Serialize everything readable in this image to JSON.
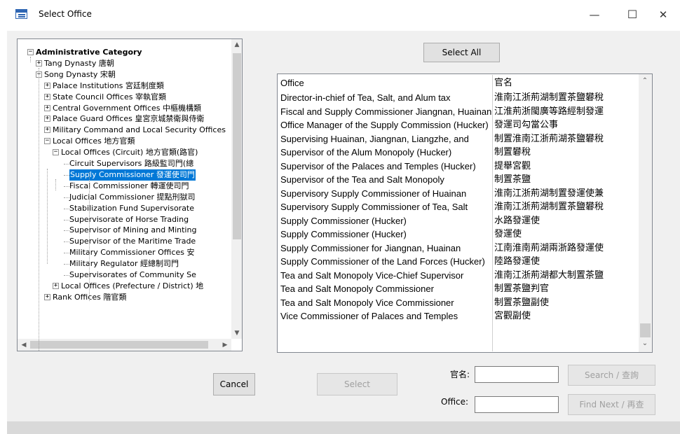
{
  "window": {
    "title": "Select Office",
    "minimize": "—",
    "maximize": "☐",
    "close": "✕"
  },
  "tree": {
    "root": "Administrative Category",
    "items": [
      {
        "label": "Tang Dynasty 唐朝",
        "exp": "+"
      },
      {
        "label": "Song Dynasty 宋朝",
        "exp": "-"
      },
      {
        "label": "Palace Institutions 宮廷制度類",
        "exp": "+"
      },
      {
        "label": "State Council Offices 宰執官類",
        "exp": "+"
      },
      {
        "label": "Central Government Offices 中樞機構類",
        "exp": "+"
      },
      {
        "label": "Palace Guard Offices 皇宮京城禁衛與侍衛",
        "exp": "+"
      },
      {
        "label": "Military Command and Local Security Offices",
        "exp": "+"
      },
      {
        "label": "Local Offices 地方官類",
        "exp": "-"
      },
      {
        "label": "Local Offices (Circuit) 地方官類(路官)",
        "exp": "-"
      },
      {
        "label": "Circuit Supervisors 路級監司門(總",
        "exp": ""
      },
      {
        "label": "Supply Commissioner 發運使司門",
        "exp": ""
      },
      {
        "label": "Fiscal Commissioner 轉運使司門",
        "exp": ""
      },
      {
        "label": "Judicial Commissioner 提點刑獄司",
        "exp": ""
      },
      {
        "label": "Stabilization Fund Supervisorate",
        "exp": ""
      },
      {
        "label": "Supervisorate of Horse Trading",
        "exp": ""
      },
      {
        "label": "Supervisor of Mining and Minting",
        "exp": ""
      },
      {
        "label": "Supervisor of the Maritime Trade",
        "exp": ""
      },
      {
        "label": "Military Commissioner Offices 安",
        "exp": ""
      },
      {
        "label": "Military Regulator 經總制司門",
        "exp": ""
      },
      {
        "label": "Supervisorates of Community Se",
        "exp": ""
      },
      {
        "label": "Local Offices (Prefecture / District) 地",
        "exp": "+"
      },
      {
        "label": "Rank Offices 階官類",
        "exp": "+"
      }
    ]
  },
  "buttons": {
    "select_all": "Select All",
    "cancel": "Cancel",
    "select": "Select",
    "search": "Search / 查詢",
    "find_next": "Find Next / 再查"
  },
  "list": {
    "headers": [
      "Office",
      "官名"
    ],
    "rows": [
      [
        "Director-in-chief of Tea, Salt, and Alum tax",
        "淮南江浙荊湖制置茶鹽礬稅"
      ],
      [
        "Fiscal and Supply Commissioner Jiangnan, Huainan",
        "江淮荊浙閩廣等路經制發運"
      ],
      [
        "Office Manager of the Supply Commission (Hucker)",
        "發運司勾當公事"
      ],
      [
        "Supervising Huainan, Jiangnan, Liangzhe, and",
        "制置淮南江浙荊湖茶鹽礬稅"
      ],
      [
        "Supervisor of the Alum Monopoly (Hucker)",
        "制置礬稅"
      ],
      [
        "Supervisor of the Palaces and Temples (Hucker)",
        "提舉宮觀"
      ],
      [
        "Supervisor of the Tea and Salt Monopoly",
        "制置茶鹽"
      ],
      [
        "Supervisory Supply Commissioner of Huainan",
        "淮南江浙荊湖制置發運使兼"
      ],
      [
        "Supervisory Supply Commissioner of Tea, Salt",
        "淮南江浙荊湖制置茶鹽礬稅"
      ],
      [
        "Supply Commissioner (Hucker)",
        "水路發運使"
      ],
      [
        "Supply Commissioner (Hucker)",
        "發運使"
      ],
      [
        "Supply Commissioner for Jiangnan, Huainan",
        "江南淮南荊湖兩浙路發運使"
      ],
      [
        "Supply Commissioner of the Land Forces (Hucker)",
        "陸路發運使"
      ],
      [
        "Tea and Salt Monopoly  Vice-Chief Supervisor",
        "淮南江浙荊湖都大制置茶鹽"
      ],
      [
        "Tea and Salt Monopoly Commissioner",
        "制置茶鹽判官"
      ],
      [
        "Tea and Salt Monopoly Vice Commissioner",
        "制置茶鹽副使"
      ],
      [
        "Vice Commissioner of Palaces and Temples",
        "宮觀副使"
      ]
    ]
  },
  "search": {
    "guanming_label": "官名:",
    "office_label": "Office:",
    "guanming_value": "",
    "office_value": ""
  }
}
